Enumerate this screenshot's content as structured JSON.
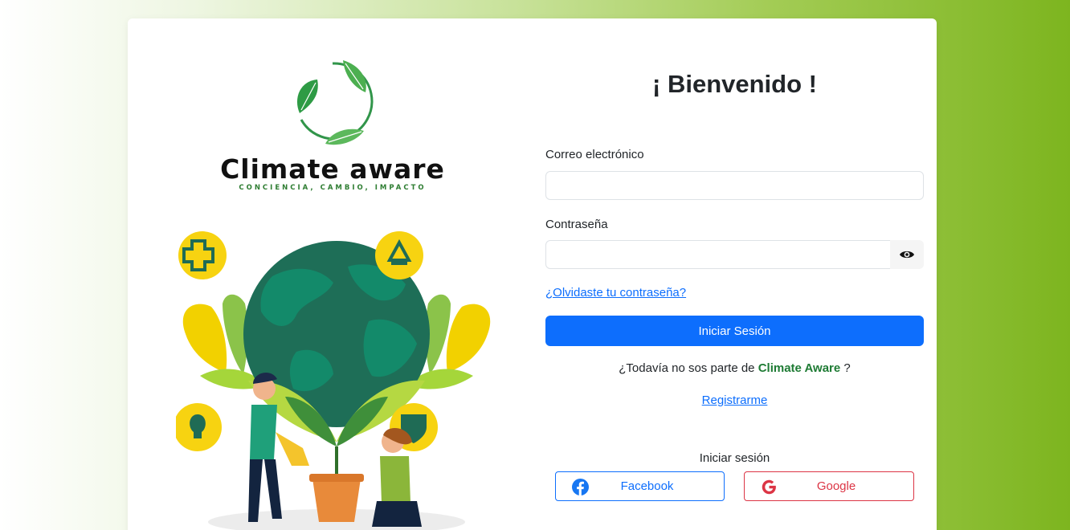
{
  "brand": {
    "name": "Climate aware",
    "tagline": "CONCIENCIA, CAMBIO, IMPACTO"
  },
  "form": {
    "title": "¡ Bienvenido !",
    "email_label": "Correo electrónico",
    "email_value": "",
    "password_label": "Contraseña",
    "password_value": "",
    "forgot_link": "¿Olvidaste tu contraseña?",
    "submit_label": "Iniciar Sesión",
    "signup_prompt_prefix": "¿Todavía no sos parte de ",
    "signup_prompt_brand": "Climate Aware",
    "signup_prompt_suffix": " ?",
    "register_link": "Registrarme",
    "social_heading": "Iniciar sesión"
  },
  "social": {
    "facebook_label": "Facebook",
    "google_label": "Google"
  },
  "colors": {
    "primary": "#0d6efd",
    "facebook": "#1877f2",
    "google": "#dc3545",
    "brand_green": "#1e7b34"
  },
  "icons": {
    "password_toggle": "eye-icon",
    "facebook": "facebook-icon",
    "google": "google-icon"
  }
}
